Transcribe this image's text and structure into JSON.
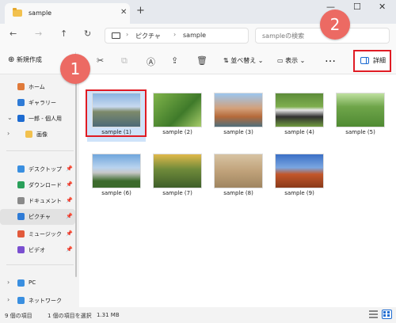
{
  "window": {
    "tab_title": "sample",
    "tab_close": "✕",
    "tab_add": "+",
    "minimize": "—",
    "maximize": "☐",
    "close": "✕"
  },
  "nav": {
    "back": "←",
    "forward": "→",
    "up": "↑",
    "refresh": "↻",
    "breadcrumb": [
      "ピクチャ",
      "sample"
    ],
    "chevron": "›",
    "search_placeholder": "sampleの検索"
  },
  "toolbar": {
    "new_label": "新規作成",
    "new_icon": "⊕",
    "sort_label": "並べ替え",
    "view_label": "表示",
    "more_label": "…",
    "detail_label": "詳細",
    "dropdown": "⌄"
  },
  "sidebar": {
    "items": [
      {
        "label": "ホーム",
        "icon": "home-icon",
        "color": "#e07a3a"
      },
      {
        "label": "ギャラリー",
        "icon": "gallery-icon",
        "color": "#2f7bd6"
      },
      {
        "label": "一郎 - 個人用",
        "icon": "cloud-icon",
        "color": "#1d6bd1"
      },
      {
        "label": "画像",
        "icon": "folder-icon",
        "color": "#f2c14e"
      },
      {
        "label": "デスクトップ",
        "icon": "desktop-icon",
        "color": "#3a8fe0"
      },
      {
        "label": "ダウンロード",
        "icon": "download-icon",
        "color": "#2aa05a"
      },
      {
        "label": "ドキュメント",
        "icon": "document-icon",
        "color": "#8a8a8a"
      },
      {
        "label": "ピクチャ",
        "icon": "pictures-icon",
        "color": "#2f7bd6"
      },
      {
        "label": "ミュージック",
        "icon": "music-icon",
        "color": "#e25a3c"
      },
      {
        "label": "ビデオ",
        "icon": "video-icon",
        "color": "#7a4fd0"
      },
      {
        "label": "PC",
        "icon": "pc-icon",
        "color": "#3a8fe0"
      },
      {
        "label": "ネットワーク",
        "icon": "network-icon",
        "color": "#3a8fe0"
      }
    ]
  },
  "files": [
    {
      "name": "sample (1)"
    },
    {
      "name": "sample (2)"
    },
    {
      "name": "sample (3)"
    },
    {
      "name": "sample (4)"
    },
    {
      "name": "sample (5)"
    },
    {
      "name": "sample (6)"
    },
    {
      "name": "sample (7)"
    },
    {
      "name": "sample (8)"
    },
    {
      "name": "sample (9)"
    }
  ],
  "badges": {
    "one": "1",
    "two": "2"
  },
  "status": {
    "count": "9 個の項目",
    "selected": "1 個の項目を選択",
    "size": "1.31 MB"
  },
  "colors": {
    "accent": "#1d6bd1",
    "highlight": "#e01c24",
    "badge": "#ec6a63",
    "selected_tile": "#cfe3fa"
  }
}
